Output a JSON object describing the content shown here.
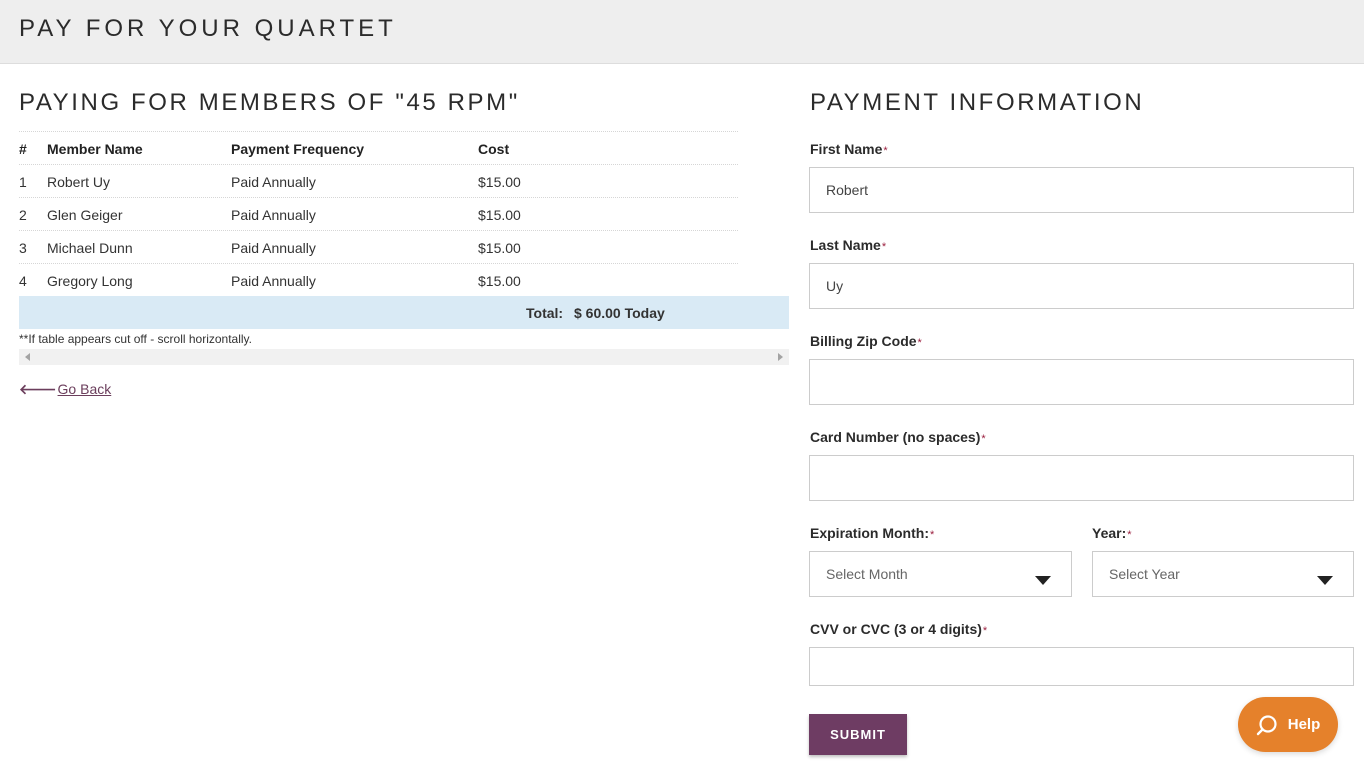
{
  "header": {
    "title": "PAY FOR YOUR QUARTET"
  },
  "members_section": {
    "title": "PAYING FOR MEMBERS OF \"45 RPM\"",
    "columns": [
      "#",
      "Member Name",
      "Payment Frequency",
      "Cost"
    ],
    "rows": [
      {
        "num": "1",
        "name": "Robert Uy",
        "frequency": "Paid Annually",
        "cost": "$15.00"
      },
      {
        "num": "2",
        "name": "Glen Geiger",
        "frequency": "Paid Annually",
        "cost": "$15.00"
      },
      {
        "num": "3",
        "name": "Michael Dunn",
        "frequency": "Paid Annually",
        "cost": "$15.00"
      },
      {
        "num": "4",
        "name": "Gregory Long",
        "frequency": "Paid Annually",
        "cost": "$15.00"
      }
    ],
    "total_label": "Total:",
    "total_value": "$ 60.00 Today",
    "note": "**If table appears cut off - scroll horizontally.",
    "go_back": "Go Back"
  },
  "payment": {
    "title": "PAYMENT INFORMATION",
    "first_name": {
      "label": "First Name",
      "value": "Robert"
    },
    "last_name": {
      "label": "Last Name",
      "value": "Uy"
    },
    "zip": {
      "label": "Billing Zip Code",
      "value": ""
    },
    "card": {
      "label": "Card Number (no spaces)",
      "value": ""
    },
    "exp_month": {
      "label": "Expiration Month:",
      "value": "Select Month"
    },
    "exp_year": {
      "label": "Year:",
      "value": "Select Year"
    },
    "cvv": {
      "label": "CVV or CVC (3 or 4 digits)",
      "value": ""
    },
    "required_mark": "*",
    "submit": "SUBMIT"
  },
  "help": {
    "label": "Help"
  },
  "colors": {
    "accent": "#6e3c63",
    "help": "#e5812b",
    "total_bg": "#d9eaf5",
    "required": "#9a1d3d"
  },
  "icons": {
    "back": "arrow-left-icon",
    "help": "search-icon",
    "select": "caret-down-icon"
  }
}
